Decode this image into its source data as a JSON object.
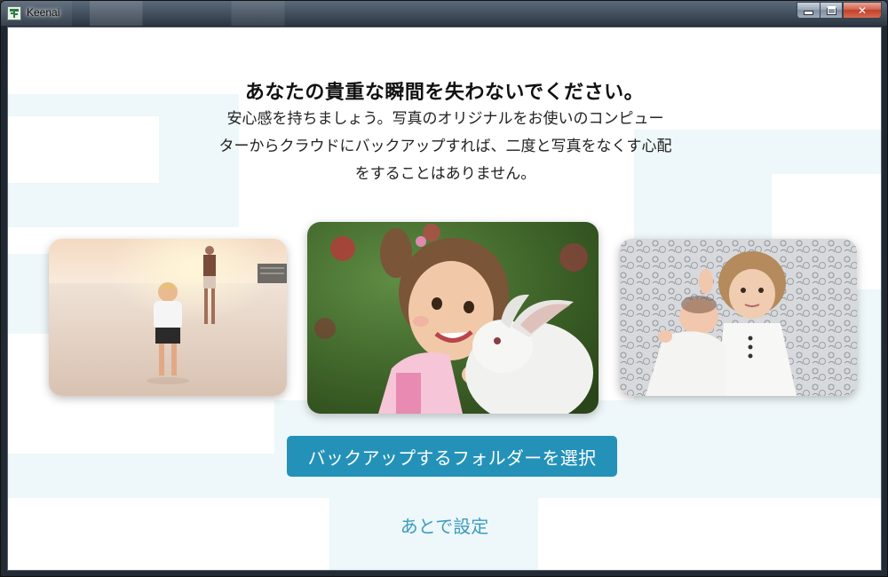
{
  "window": {
    "title": "Keenai",
    "controls": {
      "minimize": "minimize",
      "maximize": "maximize",
      "close": "✕"
    }
  },
  "main": {
    "headline": "あなたの貴重な瞬間を失わないでください。",
    "description_lines": [
      "安心感を持ちましょう。写真のオリジナルをお使いのコンピュー",
      "ターからクラウドにバックアップすれば、二度と写真をなくす心配",
      "をすることはありません。"
    ],
    "photos": [
      {
        "subject": "child-on-beach-photo"
      },
      {
        "subject": "girl-with-rabbit-photo"
      },
      {
        "subject": "baby-and-girl-photo"
      }
    ],
    "primary_button": "バックアップするフォルダーを選択",
    "secondary_link": "あとで設定"
  },
  "colors": {
    "accent": "#2492b8",
    "link": "#3b9cbf",
    "background_pattern": "#eef7f9"
  }
}
